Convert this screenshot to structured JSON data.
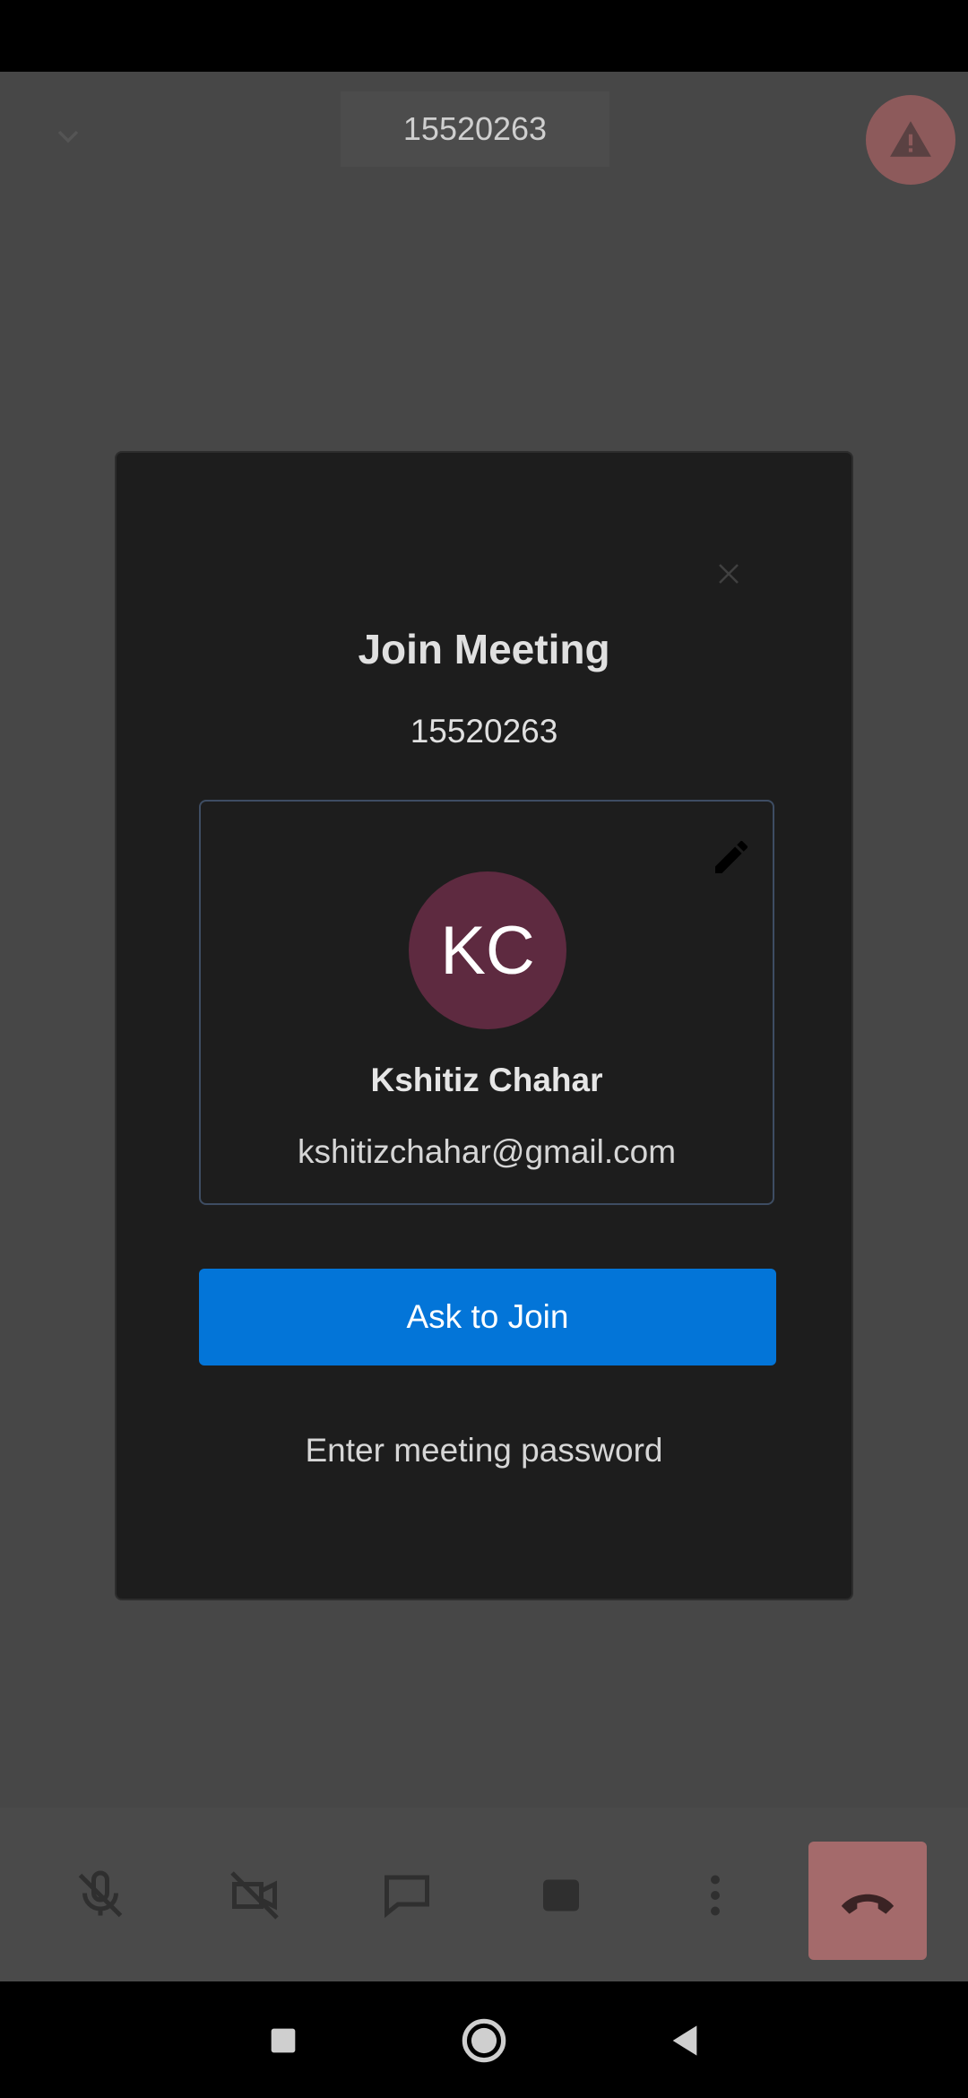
{
  "topbar": {
    "meeting_id": "15520263"
  },
  "dialog": {
    "title": "Join Meeting",
    "meeting_id": "15520263",
    "profile": {
      "initials": "KC",
      "name": "Kshitiz Chahar",
      "email": "kshitizchahar@gmail.com",
      "avatar_color": "#5e2a40"
    },
    "ask_button_label": "Ask to Join",
    "password_link": "Enter meeting password"
  },
  "colors": {
    "primary": "#0375d8",
    "hangup": "#a46a6b",
    "dialog_bg": "#1d1d1d"
  },
  "toolbar": {
    "icons": [
      "mic-off-icon",
      "video-off-icon",
      "chat-icon",
      "share-icon",
      "more-icon",
      "hangup-icon"
    ]
  },
  "nav": {
    "icons": [
      "recent-apps-icon",
      "home-icon",
      "back-icon"
    ]
  }
}
